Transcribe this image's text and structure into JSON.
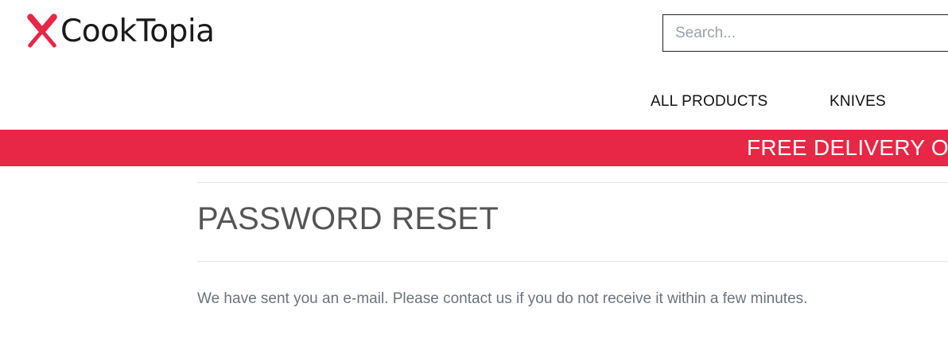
{
  "header": {
    "logo_text": "CookTopia",
    "logo_icon": "crossed-knives-icon",
    "search": {
      "placeholder": "Search...",
      "value": ""
    }
  },
  "nav": {
    "items": [
      {
        "label": "ALL PRODUCTS"
      },
      {
        "label": "KNIVES"
      }
    ]
  },
  "banner": {
    "text": "FREE DELIVERY ON"
  },
  "main": {
    "title": "PASSWORD RESET",
    "message": "We have sent you an e-mail. Please contact us if you do not receive it within a few minutes."
  },
  "colors": {
    "brand": "#e82645",
    "title": "#555555",
    "body_text": "#6c737a"
  }
}
